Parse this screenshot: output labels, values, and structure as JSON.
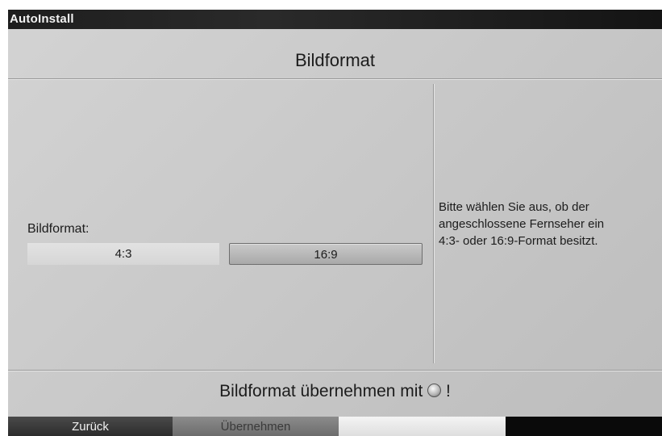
{
  "window": {
    "title": "AutoInstall"
  },
  "page": {
    "heading": "Bildformat"
  },
  "setting": {
    "label": "Bildformat:",
    "options": [
      "4:3",
      "16:9"
    ],
    "selected": "16:9"
  },
  "help": {
    "lines": [
      "Bitte wählen Sie aus, ob der",
      "angeschlossene Fernseher ein",
      "4:3- oder 16:9-Format besitzt."
    ]
  },
  "confirm": {
    "text_before": "Bildformat übernehmen mit",
    "icon": "ok-button-icon",
    "text_after": "!"
  },
  "function_keys": [
    {
      "color": "red",
      "label": "Zurück"
    },
    {
      "color": "green",
      "label": "Übernehmen"
    },
    {
      "color": "yellow",
      "label": ""
    },
    {
      "color": "blue",
      "label": ""
    }
  ]
}
